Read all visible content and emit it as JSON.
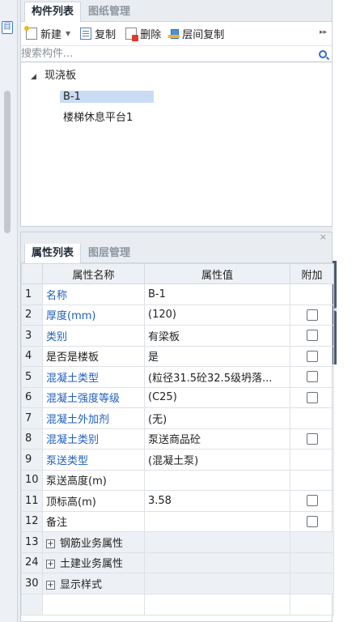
{
  "component_panel": {
    "tabs": [
      {
        "label": "构件列表",
        "active": true
      },
      {
        "label": "图纸管理",
        "active": false
      }
    ],
    "toolbar": {
      "new_label": "新建",
      "copy_label": "复制",
      "delete_label": "删除",
      "floor_copy_label": "层间复制",
      "more_label": "▸▸"
    },
    "search": {
      "placeholder": "搜索构件..."
    },
    "tree": {
      "root": {
        "label": "现浇板",
        "expanded": true
      },
      "children": [
        {
          "label": "B-1",
          "selected": true
        },
        {
          "label": "楼梯休息平台1",
          "selected": false
        }
      ]
    }
  },
  "property_panel": {
    "close_label": "×",
    "tabs": [
      {
        "label": "属性列表",
        "active": true
      },
      {
        "label": "图层管理",
        "active": false
      }
    ],
    "columns": {
      "name": "属性名称",
      "value": "属性值",
      "extra": "附加"
    },
    "rows": [
      {
        "num": "1",
        "name": "名称",
        "value": "B-1",
        "blue": true,
        "checkbox": false
      },
      {
        "num": "2",
        "name": "厚度(mm)",
        "value": "(120)",
        "blue": true,
        "checkbox": true
      },
      {
        "num": "3",
        "name": "类别",
        "value": "有梁板",
        "blue": true,
        "checkbox": true
      },
      {
        "num": "4",
        "name": "是否是楼板",
        "value": "是",
        "blue": false,
        "checkbox": true
      },
      {
        "num": "5",
        "name": "混凝土类型",
        "value": "(粒径31.5砼32.5级坍落...",
        "blue": true,
        "checkbox": true
      },
      {
        "num": "6",
        "name": "混凝土强度等级",
        "value": "(C25)",
        "blue": true,
        "checkbox": true
      },
      {
        "num": "7",
        "name": "混凝土外加剂",
        "value": "(无)",
        "blue": true,
        "checkbox": false
      },
      {
        "num": "8",
        "name": "混凝土类别",
        "value": "泵送商品砼",
        "blue": true,
        "checkbox": true
      },
      {
        "num": "9",
        "name": "泵送类型",
        "value": "(混凝土泵)",
        "blue": true,
        "checkbox": false
      },
      {
        "num": "10",
        "name": "泵送高度(m)",
        "value": "",
        "blue": false,
        "checkbox": false
      },
      {
        "num": "11",
        "name": "顶标高(m)",
        "value": "3.58",
        "blue": false,
        "checkbox": true
      },
      {
        "num": "12",
        "name": "备注",
        "value": "",
        "blue": false,
        "checkbox": true
      }
    ],
    "groups": [
      {
        "num": "13",
        "label": "钢筋业务属性"
      },
      {
        "num": "24",
        "label": "土建业务属性"
      },
      {
        "num": "30",
        "label": "显示样式"
      }
    ]
  },
  "colors": {
    "blue_label": "#1f5fbf",
    "selection": "#c9dcf3",
    "accent": "#2b6cc4"
  }
}
